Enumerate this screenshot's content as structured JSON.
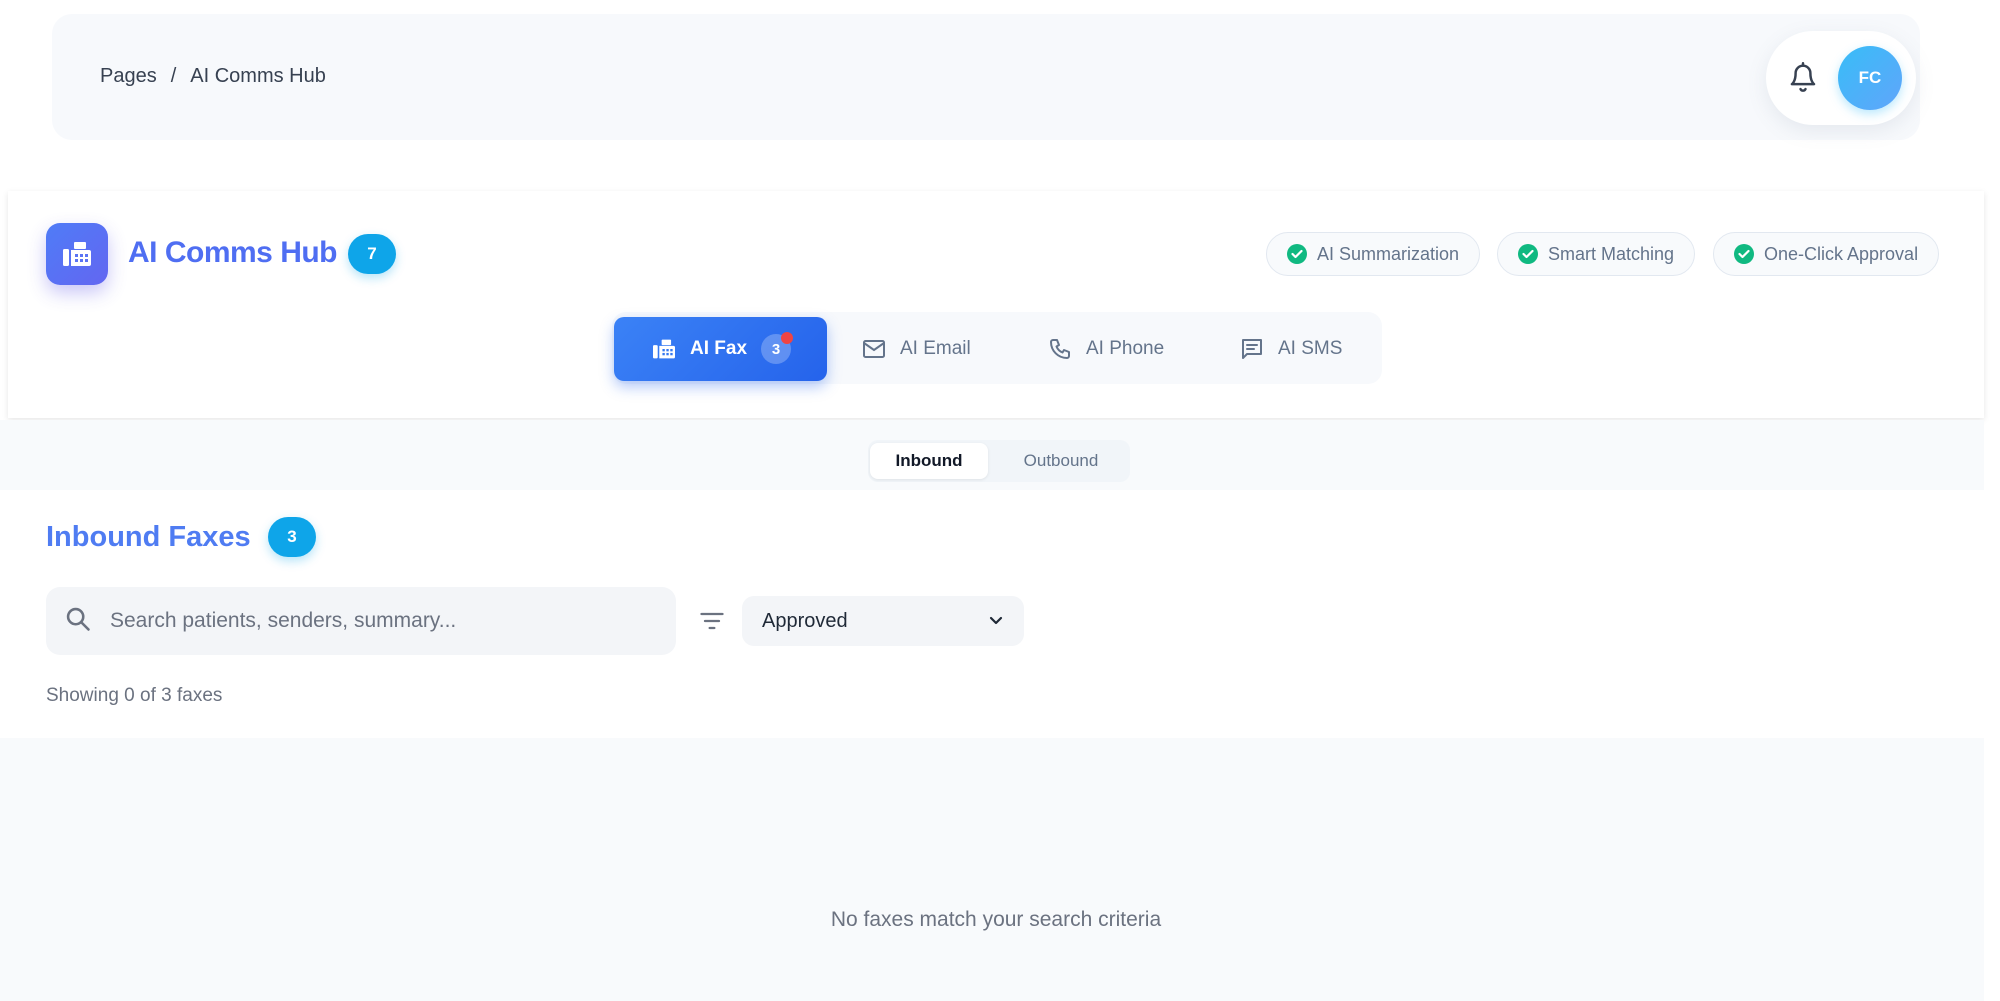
{
  "breadcrumb": {
    "root": "Pages",
    "separator": "/",
    "current": "AI Comms Hub"
  },
  "user": {
    "initials": "FC"
  },
  "hub": {
    "title": "AI Comms Hub",
    "total_count": "7",
    "features": [
      {
        "label": "AI Summarization"
      },
      {
        "label": "Smart Matching"
      },
      {
        "label": "One-Click Approval"
      }
    ]
  },
  "channels": [
    {
      "label": "AI Fax",
      "badge": "3",
      "active": true,
      "icon": "fax-icon"
    },
    {
      "label": "AI Email",
      "active": false,
      "icon": "mail-icon"
    },
    {
      "label": "AI Phone",
      "active": false,
      "icon": "phone-icon"
    },
    {
      "label": "AI SMS",
      "active": false,
      "icon": "sms-icon"
    }
  ],
  "direction": {
    "inbound": "Inbound",
    "outbound": "Outbound",
    "selected": "Inbound"
  },
  "list": {
    "title": "Inbound Faxes",
    "count": "3",
    "search_placeholder": "Search patients, senders, summary...",
    "search_value": "",
    "filter_value": "Approved",
    "showing_text": "Showing 0 of 3 faxes",
    "empty_text": "No faxes match your search criteria"
  },
  "colors": {
    "accent": "#3b82f6",
    "title": "#4f6ef2",
    "badge": "#0ea5e9",
    "success": "#10b981",
    "alert_dot": "#ef4444"
  }
}
